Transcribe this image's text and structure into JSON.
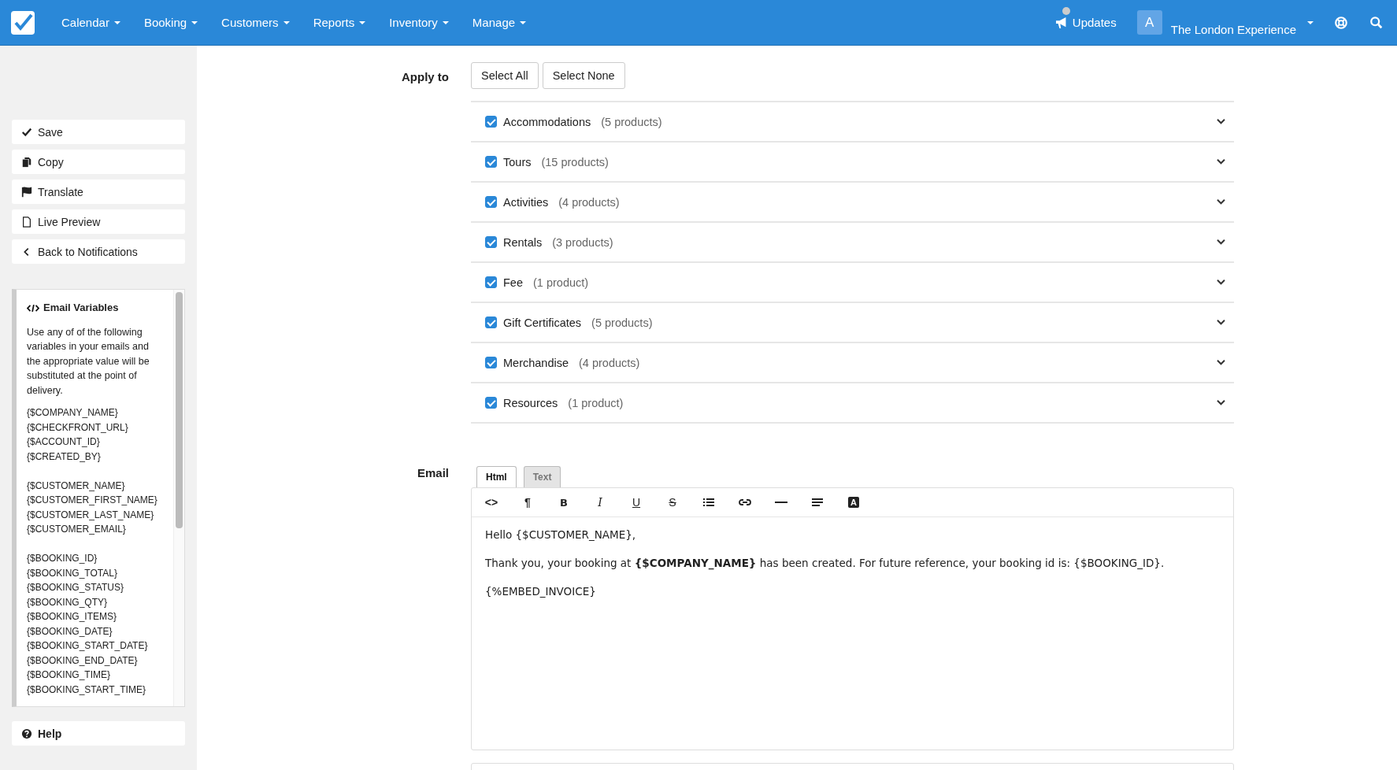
{
  "navbar": {
    "menus": [
      "Calendar",
      "Booking",
      "Customers",
      "Reports",
      "Inventory",
      "Manage"
    ],
    "updates": "Updates",
    "avatar": "A",
    "account": "The London Experience"
  },
  "sidebar": {
    "actions": [
      {
        "kind": "save",
        "label": "Save"
      },
      {
        "kind": "copy",
        "label": "Copy"
      },
      {
        "kind": "translate",
        "label": "Translate"
      },
      {
        "kind": "preview",
        "label": "Live Preview"
      },
      {
        "kind": "back",
        "label": "Back to Notifications"
      }
    ],
    "variables": {
      "title": "Email Variables",
      "intro": "Use any of of the following variables in your emails and the appropriate value will be substituted at the point of delivery.",
      "groups": [
        [
          "{$COMPANY_NAME}",
          "{$CHECKFRONT_URL}",
          "{$ACCOUNT_ID}",
          "{$CREATED_BY}"
        ],
        [
          "{$CUSTOMER_NAME}",
          "{$CUSTOMER_FIRST_NAME}",
          "{$CUSTOMER_LAST_NAME}",
          "{$CUSTOMER_EMAIL}"
        ],
        [
          "{$BOOKING_ID}",
          "{$BOOKING_TOTAL}",
          "{$BOOKING_STATUS}",
          "{$BOOKING_QTY}",
          "{$BOOKING_ITEMS}",
          "{$BOOKING_DATE}",
          "{$BOOKING_START_DATE}",
          "{$BOOKING_END_DATE}",
          "{$BOOKING_TIME}",
          "{$BOOKING_START_TIME}"
        ]
      ]
    },
    "help": "Help"
  },
  "apply_to": {
    "label": "Apply to",
    "buttons": [
      "Select All",
      "Select None"
    ],
    "categories": [
      {
        "name": "Accommodations",
        "count": "(5 products)",
        "checked": true
      },
      {
        "name": "Tours",
        "count": "(15 products)",
        "checked": true
      },
      {
        "name": "Activities",
        "count": "(4 products)",
        "checked": true
      },
      {
        "name": "Rentals",
        "count": "(3 products)",
        "checked": true
      },
      {
        "name": "Fee",
        "count": "(1 product)",
        "checked": true
      },
      {
        "name": "Gift Certificates",
        "count": "(5 products)",
        "checked": true
      },
      {
        "name": "Merchandise",
        "count": "(4 products)",
        "checked": true
      },
      {
        "name": "Resources",
        "count": "(1 product)",
        "checked": true
      }
    ]
  },
  "email": {
    "label": "Email",
    "tabs": [
      {
        "label": "Html",
        "selected": true
      },
      {
        "label": "Text",
        "selected": false
      }
    ],
    "toolbar": [
      {
        "kind": "code",
        "glyph": "<>"
      },
      {
        "kind": "paragraph",
        "glyph": "¶"
      },
      {
        "kind": "bold",
        "glyph": "B"
      },
      {
        "kind": "italic",
        "glyph": "I"
      },
      {
        "kind": "underline",
        "glyph": "U"
      },
      {
        "kind": "strike",
        "glyph": "S"
      },
      {
        "kind": "list"
      },
      {
        "kind": "link"
      },
      {
        "kind": "rule"
      },
      {
        "kind": "align"
      },
      {
        "kind": "color",
        "glyph": "A"
      }
    ],
    "body": [
      "Hello {$CUSTOMER_NAME},",
      "Thank you, your booking at **{$COMPANY_NAME}** has been created. For future reference, your booking id is: {$BOOKING_ID}.",
      "{%EMBED_INVOICE}"
    ]
  }
}
